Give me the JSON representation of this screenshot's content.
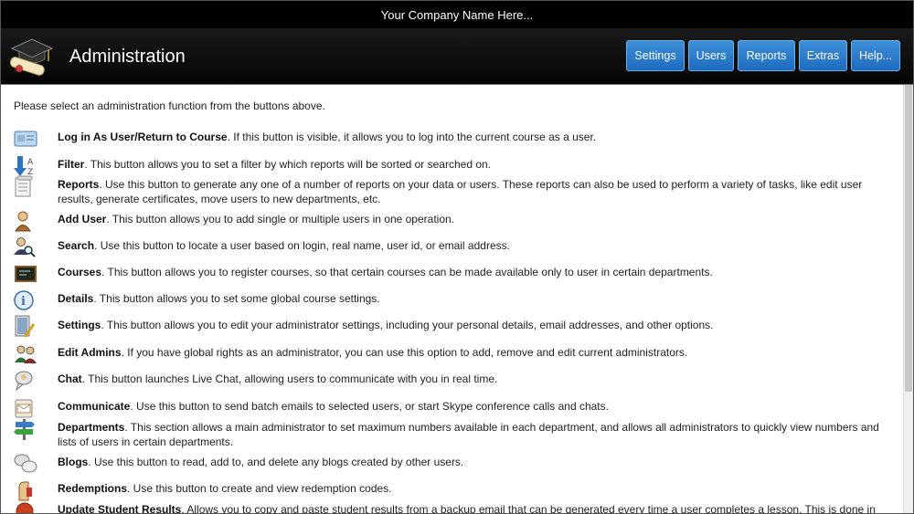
{
  "company_bar": {
    "text": "Your Company Name Here..."
  },
  "header": {
    "title": "Administration",
    "nav": [
      {
        "label": "Settings"
      },
      {
        "label": "Users"
      },
      {
        "label": "Reports"
      },
      {
        "label": "Extras"
      },
      {
        "label": "Help..."
      }
    ]
  },
  "main": {
    "intro": "Please select an administration function from the buttons above.",
    "items": [
      {
        "name": "Log in As User/Return to Course",
        "desc": ". If this button is visible, it allows you to log into the current course as a user.",
        "icon": "login-card-icon"
      },
      {
        "name": "Filter",
        "desc": ". This button allows you to set a filter by which reports will be sorted or searched on.",
        "icon": "sort-filter-icon"
      },
      {
        "name": "Reports",
        "desc": ". Use this button to generate any one of a number of reports on your data or users. These reports can also be used to perform a variety of tasks, like edit user results, generate certificates, move users to new departments, etc.",
        "icon": "reports-icon"
      },
      {
        "name": "Add User",
        "desc": ". This button allows you to add single or multiple users in one operation.",
        "icon": "add-user-icon"
      },
      {
        "name": "Search",
        "desc": ". Use this button to locate a user based on login, real name, user id, or email address.",
        "icon": "search-user-icon"
      },
      {
        "name": "Courses",
        "desc": ". This button allows you to register courses, so that certain courses can be made available only to user in certain departments.",
        "icon": "courses-icon"
      },
      {
        "name": "Details",
        "desc": ". This button allows you to set some global course settings.",
        "icon": "info-icon"
      },
      {
        "name": "Settings",
        "desc": ". This button allows you to edit your administrator settings, including your personal details, email addresses, and other options.",
        "icon": "settings-edit-icon"
      },
      {
        "name": "Edit Admins",
        "desc": ". If you have global rights as an administrator, you can use this option to add, remove and edit current administrators.",
        "icon": "admins-icon"
      },
      {
        "name": "Chat",
        "desc": ". This button launches Live Chat, allowing users to communicate with you in real time.",
        "icon": "chat-icon"
      },
      {
        "name": "Communicate",
        "desc": ". Use this button to send batch emails to selected users, or start Skype conference calls and chats.",
        "icon": "email-icon"
      },
      {
        "name": "Departments",
        "desc": ". This section allows a main administrator to set maximum numbers available in each department, and allows all administrators to quickly view numbers and lists of users in certain departments.",
        "icon": "signpost-icon"
      },
      {
        "name": "Blogs",
        "desc": ". Use this button to read, add to, and delete any blogs created by other users.",
        "icon": "blogs-icon"
      },
      {
        "name": "Redemptions",
        "desc": ". Use this button to create and view redemption codes.",
        "icon": "redemption-icon"
      },
      {
        "name": "Update Student Results",
        "desc": ". Allows you to copy and paste student results from a backup email that can be generated every time a user completes a lesson. This is done in the case",
        "icon": "update-results-icon"
      }
    ]
  }
}
